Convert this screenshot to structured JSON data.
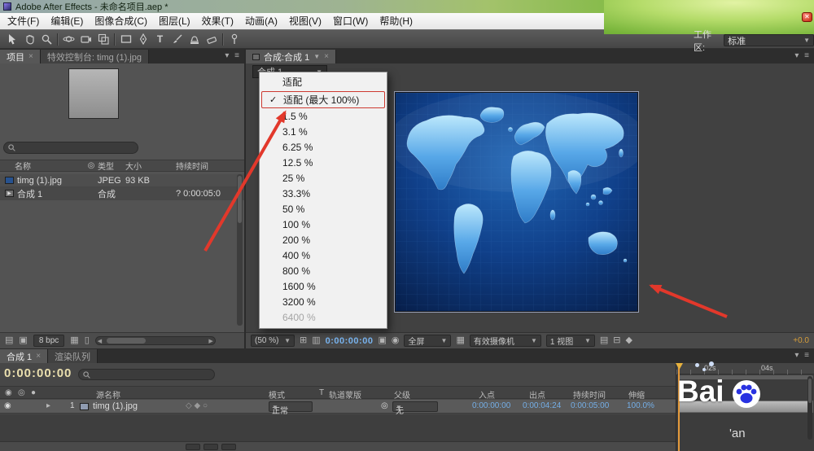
{
  "theme": {
    "annotation_red": "#e2382b",
    "highlight_red": "#cd3a31",
    "timecode_blue": "#74aee6",
    "timecode_yellow": "#eadfae",
    "exposure_orange": "#d79e3a",
    "map_blue": "#2f7cc8"
  },
  "window": {
    "title": "Adobe After Effects - 未命名项目.aep *"
  },
  "menu_bar": {
    "items": [
      "文件(F)",
      "编辑(E)",
      "图像合成(C)",
      "图层(L)",
      "效果(T)",
      "动画(A)",
      "视图(V)",
      "窗口(W)",
      "帮助(H)"
    ]
  },
  "toolbar": {
    "workspace_label": "工作区:",
    "workspace_value": "标准",
    "text_tool": "T"
  },
  "project_panel": {
    "tab_project": "项目",
    "tab_effects": "特效控制台: timg (1).jpg",
    "columns": {
      "name": "名称",
      "type": "类型",
      "size": "大小",
      "duration": "持续时间"
    },
    "rows": [
      {
        "name": "timg (1).jpg",
        "type": "JPEG",
        "size": "93 KB",
        "duration": ""
      },
      {
        "name": "合成 1",
        "type": "合成",
        "size": "",
        "duration": "? 0:00:05:0"
      }
    ],
    "bpc": "8 bpc"
  },
  "comp_panel": {
    "tab": "合成:合成 1",
    "selector": "合成 1",
    "zoom_menu": {
      "items": [
        {
          "label": "适配"
        },
        {
          "label": "适配 (最大 100%)",
          "checked": true,
          "highlighted": true
        },
        {
          "label": "1.5 %"
        },
        {
          "label": "3.1 %"
        },
        {
          "label": "6.25 %"
        },
        {
          "label": "12.5 %"
        },
        {
          "label": "25 %"
        },
        {
          "label": "33.3%"
        },
        {
          "label": "50 %"
        },
        {
          "label": "100 %"
        },
        {
          "label": "200 %"
        },
        {
          "label": "400 %"
        },
        {
          "label": "800 %"
        },
        {
          "label": "1600 %"
        },
        {
          "label": "3200 %"
        },
        {
          "label": "6400 %",
          "disabled": true
        }
      ]
    },
    "footer": {
      "zoom": "(50 %)",
      "timecode": "0:00:00:00",
      "resolution": "全屏",
      "camera": "有效摄像机",
      "view": "1 视图",
      "exposure": "+0.0"
    }
  },
  "timeline": {
    "tab_comp": "合成 1",
    "tab_queue": "渲染队列",
    "timecode": "0:00:00:00",
    "columns": {
      "source_name": "源名称",
      "mode": "模式",
      "trkmat_t": "T",
      "trkmat": "轨道蒙版",
      "parent": "父级",
      "in": "入点",
      "out": "出点",
      "duration": "持续时间",
      "stretch": "伸缩"
    },
    "layer": {
      "index": "1",
      "name": "timg (1).jpg",
      "mode": "正常",
      "parent": "无",
      "in": "0:00:00:00",
      "out": "0:00:04:24",
      "duration": "0:00:05:00",
      "stretch": "100.0%"
    },
    "ruler": {
      "t2": "02s",
      "t4": "04s"
    }
  },
  "watermark": {
    "line1": "Bai",
    "line2": "'an"
  }
}
